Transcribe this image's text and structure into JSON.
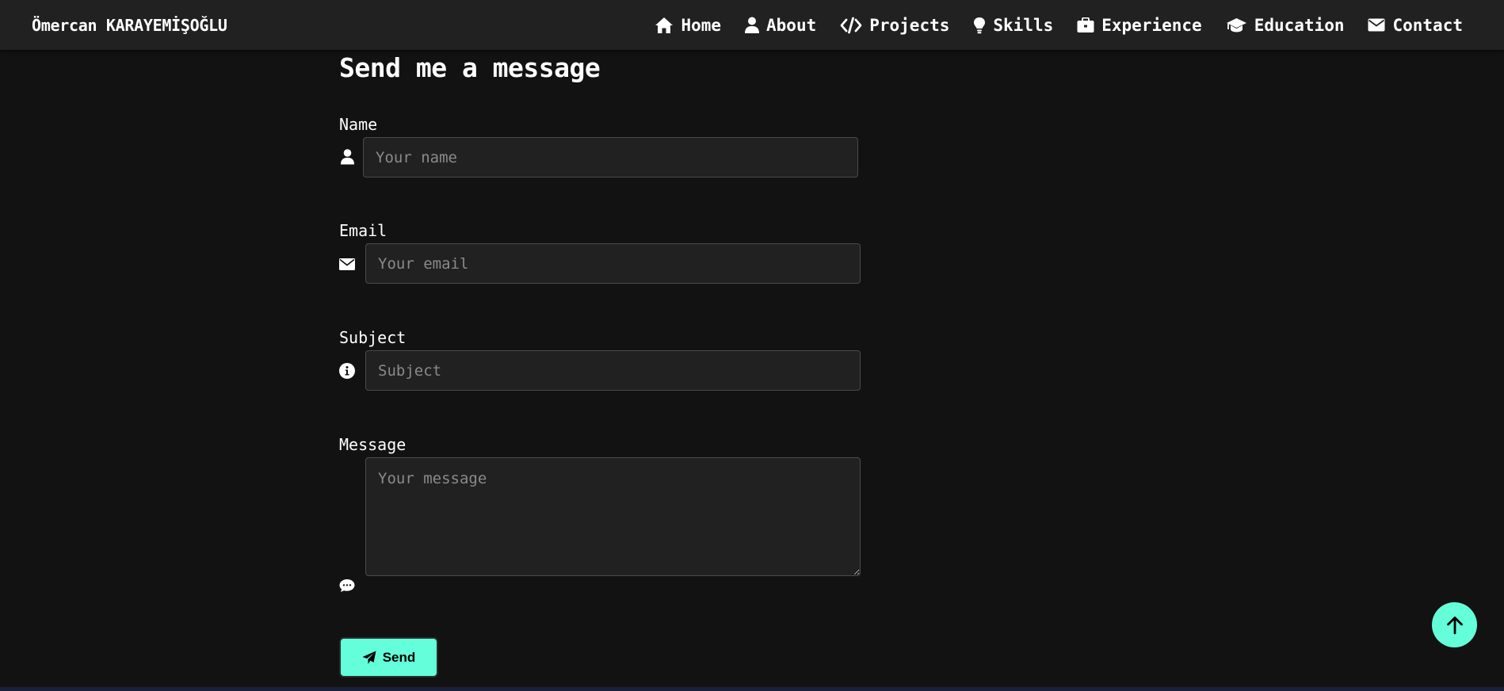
{
  "brand": "Ömercan KARAYEMİŞOĞLU",
  "nav": [
    {
      "label": "Home",
      "icon": "home-icon"
    },
    {
      "label": "About",
      "icon": "user-icon"
    },
    {
      "label": "Projects",
      "icon": "code-icon"
    },
    {
      "label": "Skills",
      "icon": "lightbulb-icon"
    },
    {
      "label": "Experience",
      "icon": "briefcase-icon"
    },
    {
      "label": "Education",
      "icon": "graduation-cap-icon"
    },
    {
      "label": "Contact",
      "icon": "envelope-icon"
    }
  ],
  "form": {
    "title": "Send me a message",
    "fields": {
      "name": {
        "label": "Name",
        "placeholder": "Your name",
        "icon": "user-icon"
      },
      "email": {
        "label": "Email",
        "placeholder": "Your email",
        "icon": "envelope-icon"
      },
      "subject": {
        "label": "Subject",
        "placeholder": "Subject",
        "icon": "info-circle-icon"
      },
      "message": {
        "label": "Message",
        "placeholder": "Your message",
        "icon": "comment-icon"
      }
    },
    "send_label": "Send",
    "send_icon": "paper-plane-icon"
  },
  "scroll_top_icon": "arrow-up-icon",
  "colors": {
    "accent": "#64ffda",
    "background": "#121212",
    "navbar": "#212121",
    "input_background": "#212121"
  }
}
